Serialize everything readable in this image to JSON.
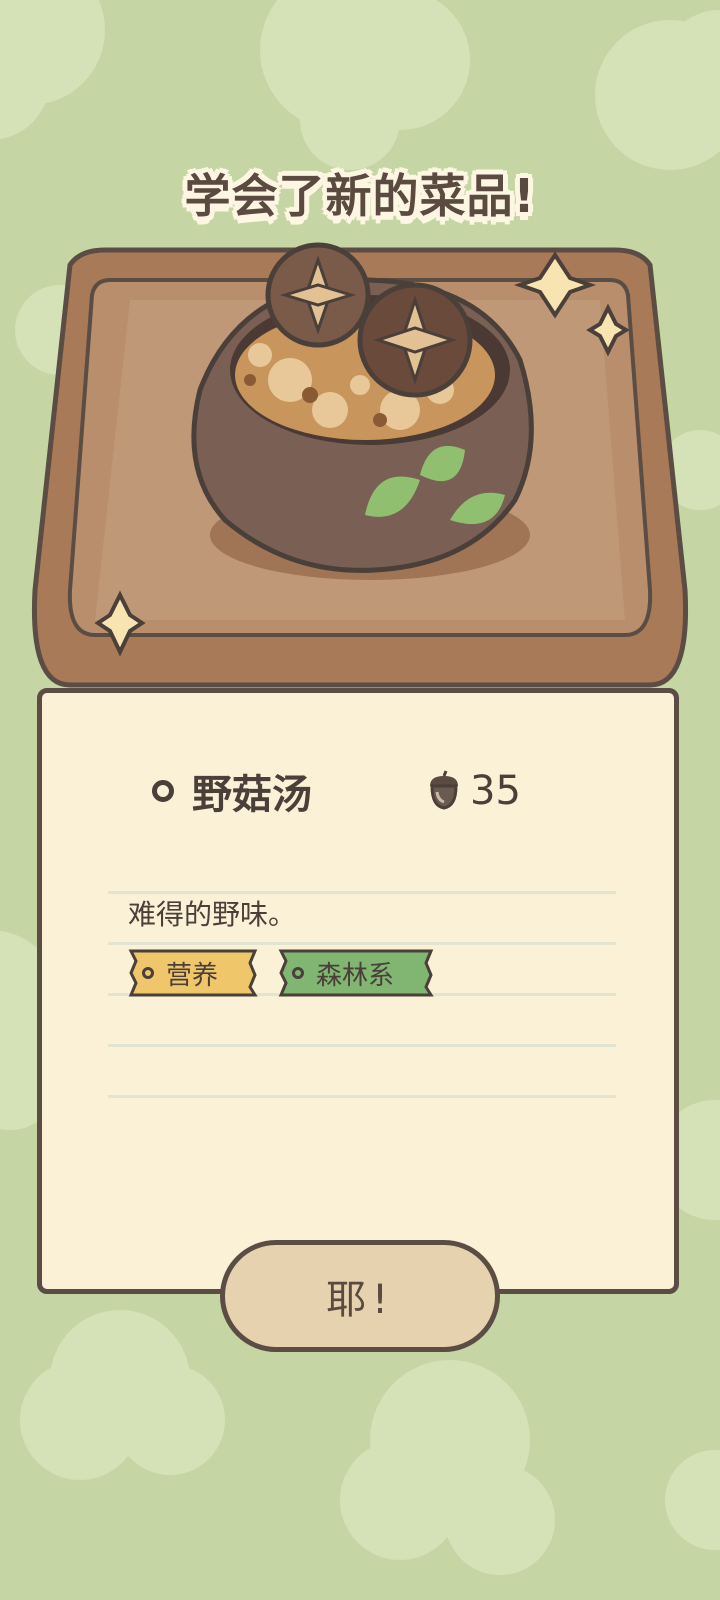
{
  "popup": {
    "title": "学会了新的菜品!",
    "dish_name": "野菇汤",
    "price": "35",
    "price_icon": "acorn-icon",
    "description": "难得的野味。",
    "tags": [
      {
        "label": "营养",
        "color": "#f0c66b"
      },
      {
        "label": "森林系",
        "color": "#80b672"
      }
    ],
    "confirm_label": "耶!"
  },
  "colors": {
    "background": "#c5d6a4",
    "card": "#faf1d6",
    "outline": "#5c4d44",
    "button": "#e6d2ae"
  }
}
